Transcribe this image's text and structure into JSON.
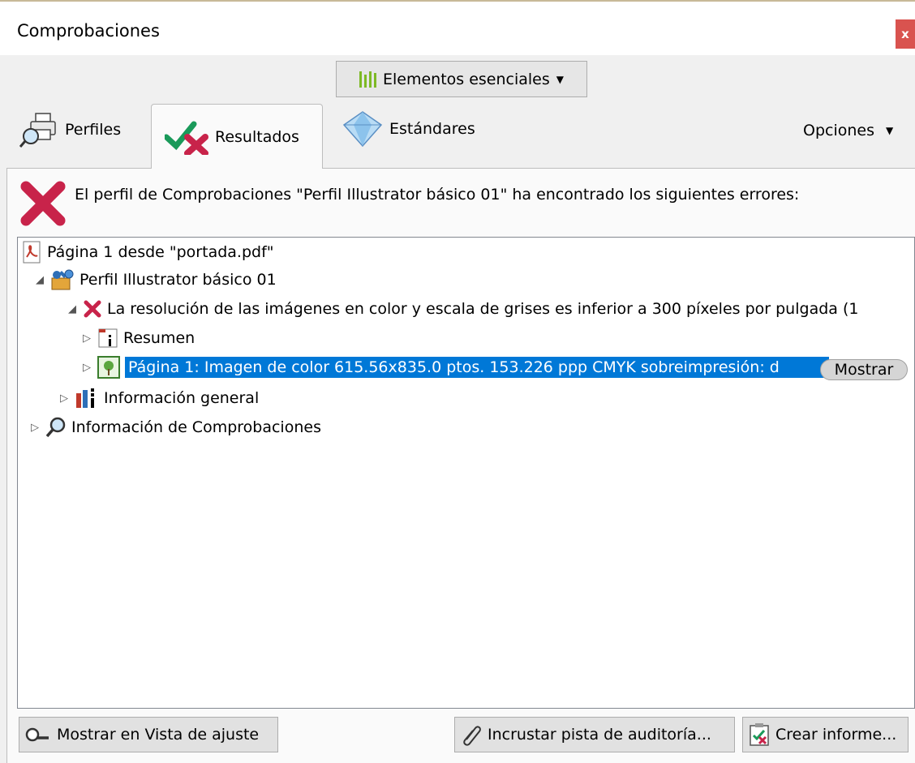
{
  "window": {
    "title": "Comprobaciones",
    "close_label": "x"
  },
  "profile_dropdown": {
    "label": "Elementos esenciales",
    "accent": "#7db925"
  },
  "tabs": {
    "perfiles": "Perfiles",
    "resultados": "Resultados",
    "estandares": "Estándares"
  },
  "options_label": "Opciones",
  "message": "El perfil de Comprobaciones \"Perfil Illustrator básico 01\" ha encontrado los siguientes errores:",
  "tree": {
    "page": "Página 1 desde \"portada.pdf\"",
    "profile": "Perfil Illustrator básico 01",
    "error": "La resolución de las imágenes en color y escala de grises es inferior a 300 píxeles por pulgada (1",
    "summary": "Resumen",
    "selected_item": "Página 1: Imagen de color 615.56x835.0 ptos. 153.226 ppp CMYK  sobreimpresión: d",
    "show_label": "Mostrar",
    "general_info": "Información general",
    "check_info": "Información de Comprobaciones"
  },
  "buttons": {
    "show_in_fit": "Mostrar en Vista de ajuste",
    "embed_audit": "Incrustar pista de auditoría...",
    "create_report": "Crear informe..."
  },
  "colors": {
    "selection": "#0078d7",
    "error": "#c8234a",
    "close": "#d9534f"
  }
}
